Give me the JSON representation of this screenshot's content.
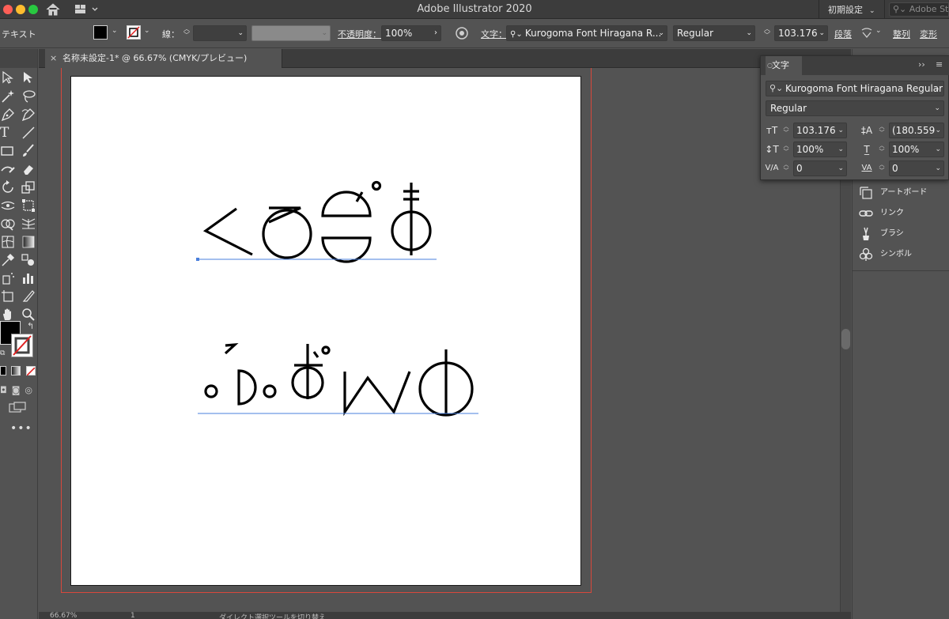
{
  "app": {
    "title": "Adobe Illustrator 2020",
    "workspace_label": "初期設定",
    "search_placeholder": "Adobe Stock を検索"
  },
  "control_bar": {
    "selection_label": "テキスト",
    "stroke_label": "線：",
    "opacity_label": "不透明度：",
    "opacity_value": "100%",
    "character_label": "文字：",
    "font_value": "Kurogoma Font Hiragana R...",
    "style_value": "Regular",
    "size_value": "103.176",
    "paragraph_label": "段落",
    "align_label": "整列",
    "transform_label": "変形"
  },
  "document": {
    "tab_label": "名称未設定-1* @ 66.67% (CMYK/プレビュー)",
    "close_glyph": "×"
  },
  "status": {
    "zoom_value": "66.67%",
    "page_value": "1",
    "tool_hint": "ダイレクト選択ツールを切り替え"
  },
  "character_panel": {
    "tab_label": "文字",
    "font_family": "Kurogoma Font Hiragana Regular",
    "font_style": "Regular",
    "font_size": "103.176",
    "leading": "(180.559",
    "vertical_scale": "100%",
    "horizontal_scale": "100%",
    "kerning": "0",
    "tracking": "0"
  },
  "right_panels": [
    {
      "label": "アートボード",
      "icon": "artboards-icon"
    },
    {
      "label": "リンク",
      "icon": "links-icon"
    },
    {
      "label": "ブラシ",
      "icon": "brushes-icon"
    },
    {
      "label": "シンボル",
      "icon": "symbols-icon"
    }
  ],
  "colors": {
    "ui_bg": "#535353",
    "title_bg": "#3c3c3c",
    "bleed_red": "#d8483c",
    "baseline_blue": "#4a7fdc"
  }
}
